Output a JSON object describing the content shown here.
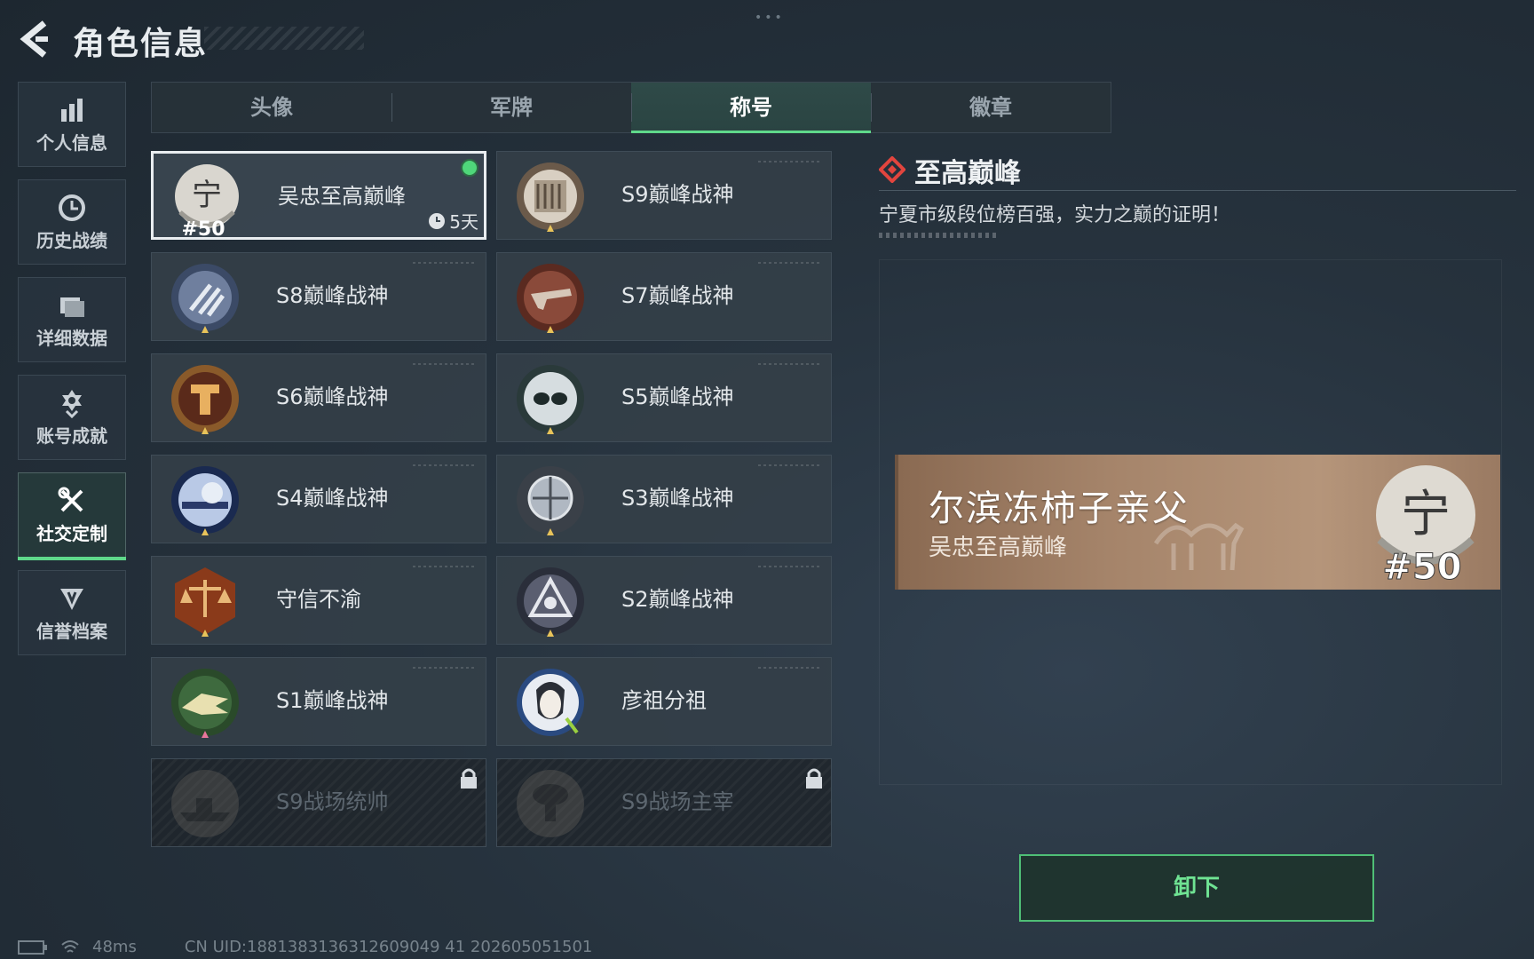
{
  "header": {
    "title": "角色信息",
    "back_icon": "back-arrow-icon"
  },
  "sidebar": {
    "items": [
      {
        "label": "个人信息",
        "icon": "bar-chart-icon"
      },
      {
        "label": "历史战绩",
        "icon": "history-clock-icon"
      },
      {
        "label": "详细数据",
        "icon": "folder-icon"
      },
      {
        "label": "账号成就",
        "icon": "achievement-icon"
      },
      {
        "label": "社交定制",
        "icon": "tools-icon",
        "active": true
      },
      {
        "label": "信誉档案",
        "icon": "shield-icon"
      }
    ]
  },
  "tabs": [
    {
      "label": "头像"
    },
    {
      "label": "军牌"
    },
    {
      "label": "称号",
      "active": true
    },
    {
      "label": "徽章"
    }
  ],
  "titles": [
    {
      "name": "吴忠至高巅峰",
      "medal_text": "#50",
      "timer": "5天",
      "selected": true,
      "equipped": true
    },
    {
      "name": "S9巅峰战神"
    },
    {
      "name": "S8巅峰战神"
    },
    {
      "name": "S7巅峰战神"
    },
    {
      "name": "S6巅峰战神"
    },
    {
      "name": "S5巅峰战神"
    },
    {
      "name": "S4巅峰战神"
    },
    {
      "name": "S3巅峰战神"
    },
    {
      "name": "守信不渝"
    },
    {
      "name": "S2巅峰战神"
    },
    {
      "name": "S1巅峰战神"
    },
    {
      "name": "彦祖分祖"
    },
    {
      "name": "S9战场统帅",
      "locked": true
    },
    {
      "name": "S9战场主宰",
      "locked": true
    }
  ],
  "detail": {
    "title": "至高巅峰",
    "description": "宁夏市级段位榜百强，实力之巅的证明！",
    "plate": {
      "main": "尔滨冻柿子亲父",
      "sub": "吴忠至高巅峰",
      "medal_text": "#50"
    },
    "action_label": "卸下"
  },
  "status": {
    "ping": "48ms",
    "uid": "CN UID:1881383136312609049 41 202605051501"
  },
  "colors": {
    "accent": "#5fd98a",
    "selected_border": "#e9edf0",
    "plate": "#a5846a"
  }
}
